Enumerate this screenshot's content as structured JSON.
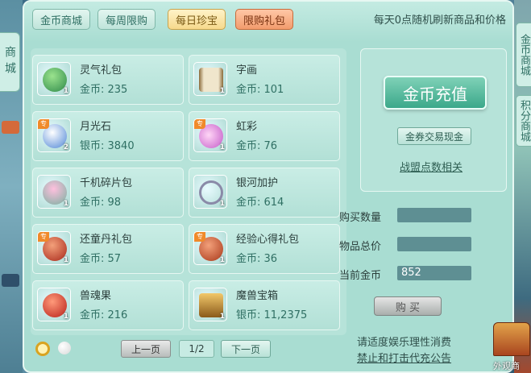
{
  "side": {
    "left_tab": "商城",
    "right_tabs": [
      "金币商城",
      "积分商城"
    ]
  },
  "tabs": [
    {
      "label": "金币商城",
      "state": "normal"
    },
    {
      "label": "每周限购",
      "state": "normal"
    },
    {
      "label": "每日珍宝",
      "state": "active"
    },
    {
      "label": "限购礼包",
      "state": "highlight"
    }
  ],
  "notice": "每天0点随机刷新商品和价格",
  "items": [
    {
      "name": "灵气礼包",
      "price": "金币: 235",
      "qty": "1",
      "tag": "",
      "icon": "gift-bag-icon",
      "color": "#4bb36b"
    },
    {
      "name": "字画",
      "price": "金币: 101",
      "qty": "1",
      "tag": "",
      "icon": "scroll-icon",
      "color": "#d8c9a6"
    },
    {
      "name": "月光石",
      "price": "银币: 3840",
      "qty": "2",
      "tag": "专",
      "icon": "moonstone-icon",
      "color": "#4f86d6"
    },
    {
      "name": "虹彩",
      "price": "金币: 76",
      "qty": "1",
      "tag": "专",
      "icon": "potion-icon",
      "color": "#c35ac8"
    },
    {
      "name": "千机碎片包",
      "price": "金币: 98",
      "qty": "1",
      "tag": "",
      "icon": "fragment-bag-icon",
      "color": "#e07aa8"
    },
    {
      "name": "银河加护",
      "price": "金币: 614",
      "qty": "1",
      "tag": "",
      "icon": "necklace-icon",
      "color": "#9a9ab8"
    },
    {
      "name": "还童丹礼包",
      "price": "金币: 57",
      "qty": "1",
      "tag": "专",
      "icon": "red-bag-icon",
      "color": "#c83a2a"
    },
    {
      "name": "经验心得礼包",
      "price": "金币: 36",
      "qty": "1",
      "tag": "专",
      "icon": "red-bag-icon",
      "color": "#c84a2a"
    },
    {
      "name": "兽魂果",
      "price": "金币: 216",
      "qty": "1",
      "tag": "",
      "icon": "fruit-icon",
      "color": "#d83a2a"
    },
    {
      "name": "魔兽宝箱",
      "price": "银币: 11,2375",
      "qty": "1",
      "tag": "",
      "icon": "treasure-chest-icon",
      "color": "#b7862e"
    }
  ],
  "pager": {
    "prev": "上一页",
    "page": "1/2",
    "next": "下一页"
  },
  "right": {
    "recharge": "金币充值",
    "exchange": "金券交易现金",
    "alliance": "战盟点数相关"
  },
  "form": {
    "qty_label": "购买数量",
    "qty_value": "",
    "total_label": "物品总价",
    "total_value": "",
    "coins_label": "当前金币",
    "coins_value": "852"
  },
  "buy": "购 买",
  "footer": {
    "line1": "请适度娱乐理性消费",
    "line2": "禁止和打击代充公告"
  },
  "chest_label": "外观商"
}
